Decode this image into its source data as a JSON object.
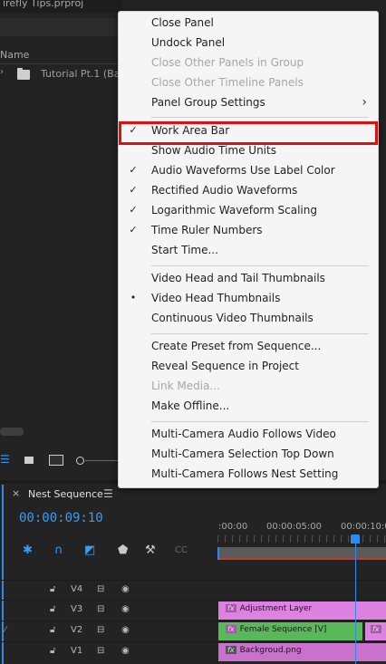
{
  "project_panel": {
    "file_title": "irefly Tips.prproj",
    "column_header": "Name",
    "folder_row": "Tutorial Pt.1 (Bac"
  },
  "timeline": {
    "close": "×",
    "sequence_title": "Nest Sequence",
    "menu_icon": "☰",
    "timecode": "00:00:09:10",
    "ruler_labels": [
      ":00:00",
      "00:00:05:00",
      "00:00:10:0"
    ],
    "tracks": [
      {
        "name": "V4",
        "clips": []
      },
      {
        "name": "V3",
        "clips": [
          {
            "label": "Adjustment Layer",
            "fx": "fx",
            "color": "#dd82e0"
          }
        ]
      },
      {
        "name": "V2",
        "clips": [
          {
            "label": "Female Sequence [V]",
            "fx": "fx",
            "color": "#58b85a"
          },
          {
            "label": "",
            "fx": "fx",
            "color": "#dd82e0"
          }
        ]
      },
      {
        "name": "V1",
        "clips": [
          {
            "label": "Backgroud.png",
            "fx": "fx",
            "color": "#c872cb"
          }
        ]
      }
    ]
  },
  "menu": {
    "items": [
      {
        "label": "Close Panel",
        "check": "",
        "disabled": false
      },
      {
        "label": "Undock Panel",
        "check": "",
        "disabled": false
      },
      {
        "label": "Close Other Panels in Group",
        "check": "",
        "disabled": true
      },
      {
        "label": "Close Other Timeline Panels",
        "check": "",
        "disabled": true
      },
      {
        "label": "Panel Group Settings",
        "check": "",
        "disabled": false,
        "submenu": "›"
      },
      {
        "label": "Work Area Bar",
        "check": "✓",
        "disabled": false,
        "highlighted": true
      },
      {
        "label": "Show Audio Time Units",
        "check": "",
        "disabled": false
      },
      {
        "label": "Audio Waveforms Use Label Color",
        "check": "✓",
        "disabled": false
      },
      {
        "label": "Rectified Audio Waveforms",
        "check": "✓",
        "disabled": false
      },
      {
        "label": "Logarithmic Waveform Scaling",
        "check": "✓",
        "disabled": false
      },
      {
        "label": "Time Ruler Numbers",
        "check": "✓",
        "disabled": false
      },
      {
        "label": "Start Time...",
        "check": "",
        "disabled": false
      },
      {
        "label": "Video Head and Tail Thumbnails",
        "check": "",
        "disabled": false
      },
      {
        "label": "Video Head Thumbnails",
        "check": "•",
        "disabled": false
      },
      {
        "label": "Continuous Video Thumbnails",
        "check": "",
        "disabled": false
      },
      {
        "label": "Create Preset from Sequence...",
        "check": "",
        "disabled": false
      },
      {
        "label": "Reveal Sequence in Project",
        "check": "",
        "disabled": false
      },
      {
        "label": "Link Media...",
        "check": "",
        "disabled": true
      },
      {
        "label": "Make Offline...",
        "check": "",
        "disabled": false
      },
      {
        "label": "Multi-Camera Audio Follows Video",
        "check": "",
        "disabled": false
      },
      {
        "label": "Multi-Camera Selection Top Down",
        "check": "",
        "disabled": false
      },
      {
        "label": "Multi-Camera Follows Nest Setting",
        "check": "",
        "disabled": false
      }
    ]
  },
  "colors": {
    "accent_blue": "#2d8ceb",
    "highlight_red": "#e01010",
    "menu_bg": "#f5f5f5"
  }
}
